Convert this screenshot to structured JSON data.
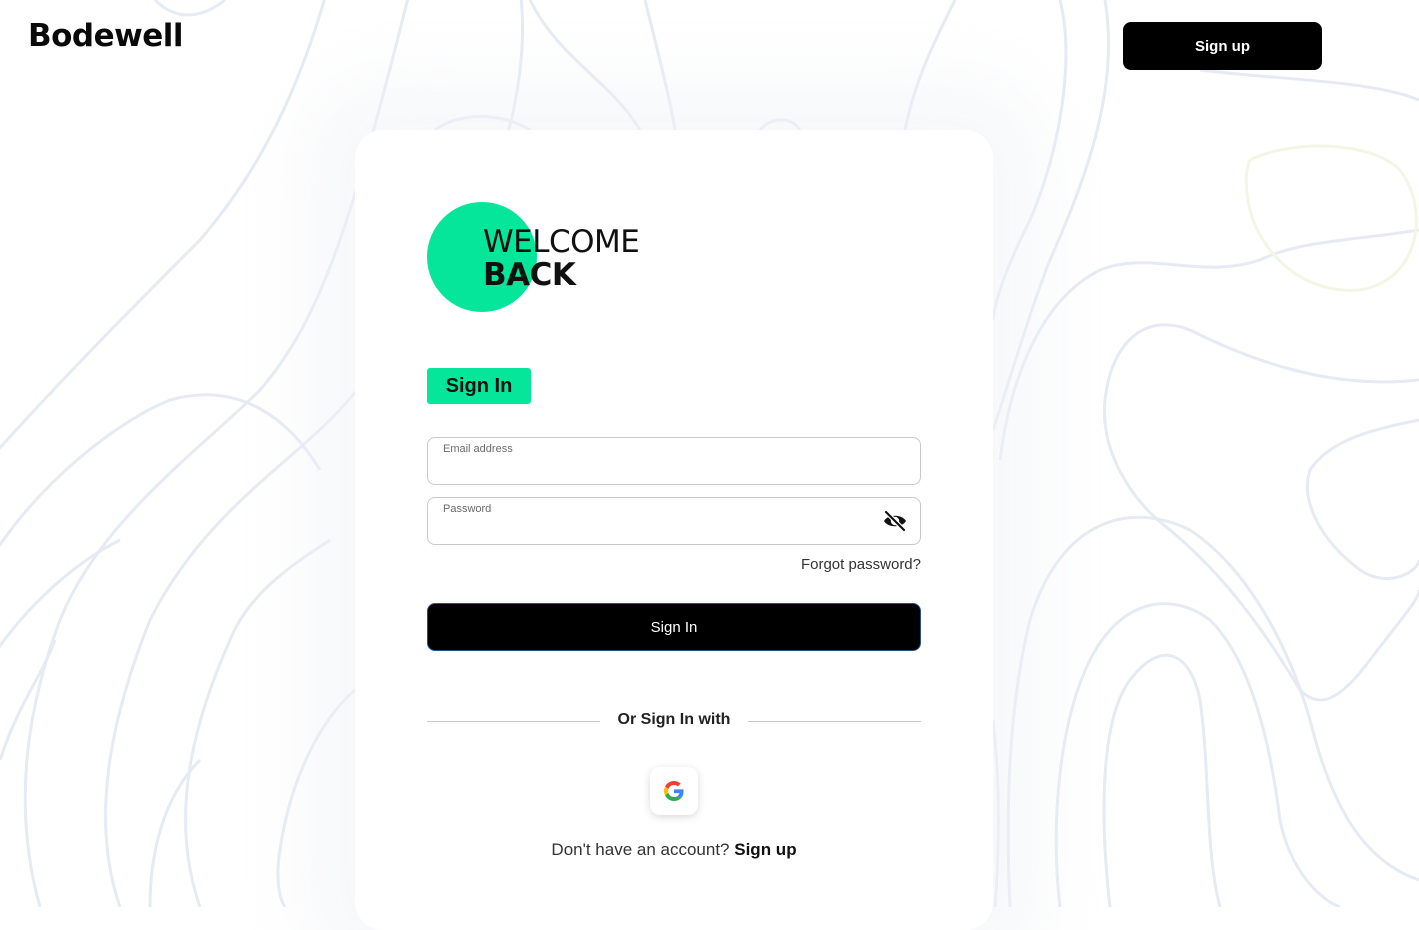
{
  "header": {
    "logo": "Bodewell",
    "signup_label": "Sign up"
  },
  "welcome": {
    "line1": "WELCOME",
    "line2": "BACK"
  },
  "form": {
    "heading": "Sign In",
    "email": {
      "label": "Email address",
      "value": ""
    },
    "password": {
      "label": "Password",
      "value": ""
    },
    "forgot_label": "Forgot password?",
    "submit_label": "Sign In",
    "or_label": "Or Sign In with"
  },
  "social": {
    "google_icon": "google-icon"
  },
  "footer": {
    "question": "Don't have an account?",
    "signup_link": "Sign up"
  },
  "colors": {
    "accent": "#05e69b",
    "primary_button": "#000000",
    "contour_lines": "#e4e9f3"
  }
}
